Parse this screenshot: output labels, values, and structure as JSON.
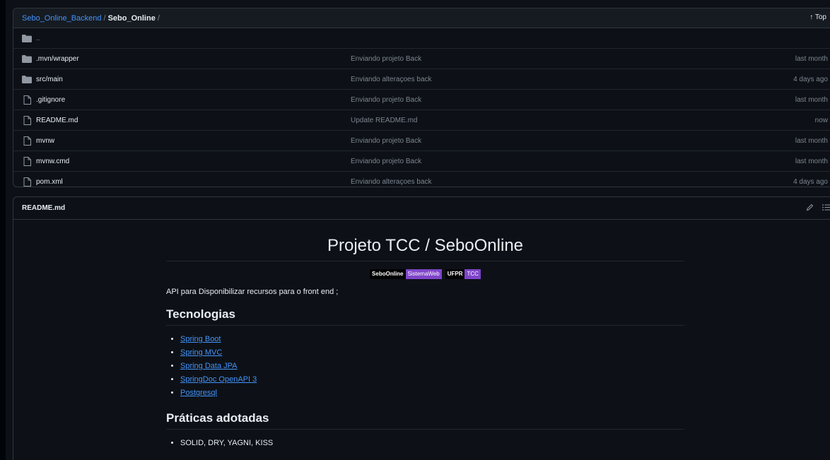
{
  "breadcrumb": {
    "repo": "Sebo_Online_Backend",
    "separator": "/",
    "current": "Sebo_Online",
    "trailing": "/"
  },
  "top_link": "↑ Top",
  "parent_dir": "..",
  "files": [
    {
      "name": ".mvn/wrapper",
      "type": "folder",
      "commit": "Enviando projeto Back",
      "age": "last month"
    },
    {
      "name": "src/main",
      "type": "folder",
      "commit": "Enviando alteraçoes back",
      "age": "4 days ago"
    },
    {
      "name": ".gitignore",
      "type": "file",
      "commit": "Enviando projeto Back",
      "age": "last month"
    },
    {
      "name": "README.md",
      "type": "file",
      "commit": "Update README.md",
      "age": "now"
    },
    {
      "name": "mvnw",
      "type": "file",
      "commit": "Enviando projeto Back",
      "age": "last month"
    },
    {
      "name": "mvnw.cmd",
      "type": "file",
      "commit": "Enviando projeto Back",
      "age": "last month"
    },
    {
      "name": "pom.xml",
      "type": "file",
      "commit": "Enviando alteraçoes back",
      "age": "4 days ago"
    }
  ],
  "readme": {
    "header": "README.md",
    "title": "Projeto TCC / SeboOnline",
    "badges": [
      {
        "left": "SeboOnline",
        "right": "SistemaWeb"
      },
      {
        "left": "UFPR",
        "right": "TCC"
      }
    ],
    "intro": "API para Disponibilizar recursos para o front end ;",
    "tech_heading": "Tecnologias",
    "technologies": [
      "Spring Boot",
      "Spring MVC",
      "Spring Data JPA",
      "SpringDoc OpenAPI 3",
      "Postgresql"
    ],
    "practices_heading": "Práticas adotadas",
    "practices": [
      "SOLID, DRY, YAGNI, KISS"
    ]
  },
  "colors": {
    "background": "#0d1117",
    "link": "#4493f8",
    "muted": "#7d8590",
    "badge_accent": "#7f45c9"
  }
}
